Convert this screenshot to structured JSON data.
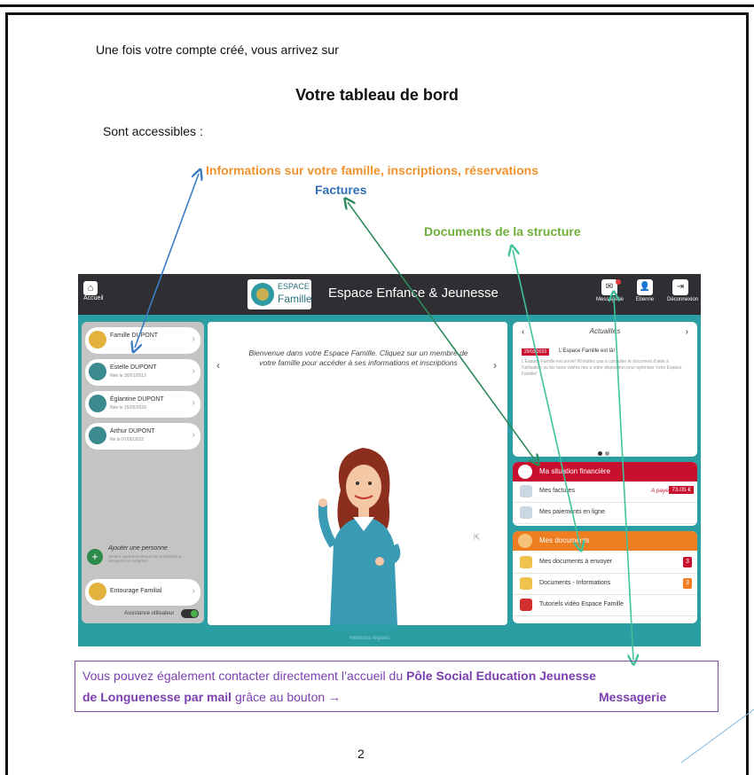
{
  "doc": {
    "intro": "Une fois votre compte créé, vous arrivez sur",
    "title": "Votre tableau de bord",
    "accessible": "Sont accessibles :",
    "label_info": "Informations sur votre famille, inscriptions, réservations",
    "label_factures": "Factures",
    "label_documents": "Documents de la  structure",
    "note": {
      "line1_a": "Vous pouvez également contacter directement l’accueil du ",
      "line1_b": "Pôle Social Education Jeunesse",
      "line2_a": "de Longuenesse par mail",
      "line2_b": " grâce au bouton →",
      "line2_c": "Messagerie"
    },
    "page_number": "2"
  },
  "app": {
    "home_label": "Accueil",
    "logo_line1": "ESPACE",
    "logo_line2": "Famille",
    "title": "Espace Enfance & Jeunesse",
    "header_buttons": {
      "messagerie": "Messagerie",
      "etienne": "Etienne",
      "deconnexion": "Déconnexion"
    },
    "members": [
      {
        "name": "Famille DUPONT",
        "sub": ""
      },
      {
        "name": "Estelle DUPONT",
        "sub": "Née le 30/01/2012"
      },
      {
        "name": "Églantine DUPONT",
        "sub": "Née le 15/05/2020"
      },
      {
        "name": "Arthur DUPONT",
        "sub": "Né le 07/09/2022"
      }
    ],
    "add_person": {
      "label": "Ajouter une personne",
      "sub": "(enfant, parent et personnes autorisées à récupérer les enfants)"
    },
    "entourage": "Entourage Familial",
    "assistance": "Assistance utilisateur",
    "welcome": "Bienvenue dans votre Espace Famille. Cliquez sur un membre de votre famille pour accéder à ses informations et inscriptions",
    "news": {
      "header": "Actualités",
      "date": "29/03/2023",
      "title": "L’Espace Famille est là!",
      "text": "L’Espace Famille est arrivé! N’hésitez pas à consulter le document d’aide à l’utilisation ou les tutos vidéos mis à votre disposition pour optimiser votre Espace Famille!"
    },
    "finance": {
      "header": "Ma situation financière",
      "factures": "Mes factures",
      "a_payer": "A payer",
      "amount": "73.05 €",
      "paiements": "Mes paiements en ligne"
    },
    "documents": {
      "header": "Mes documents",
      "envoyer": "Mes documents à envoyer",
      "envoyer_count": "3",
      "informations": "Documents - Informations",
      "informations_count": "3",
      "tutoriels": "Tutoriels vidéo Espace Famille"
    },
    "footer": "Mentions légales"
  },
  "colors": {
    "orange": "#f0922e",
    "blue": "#2f6fb5",
    "green": "#6fae3a",
    "purple": "#7b3fb0",
    "teal": "#2a9ea3"
  }
}
